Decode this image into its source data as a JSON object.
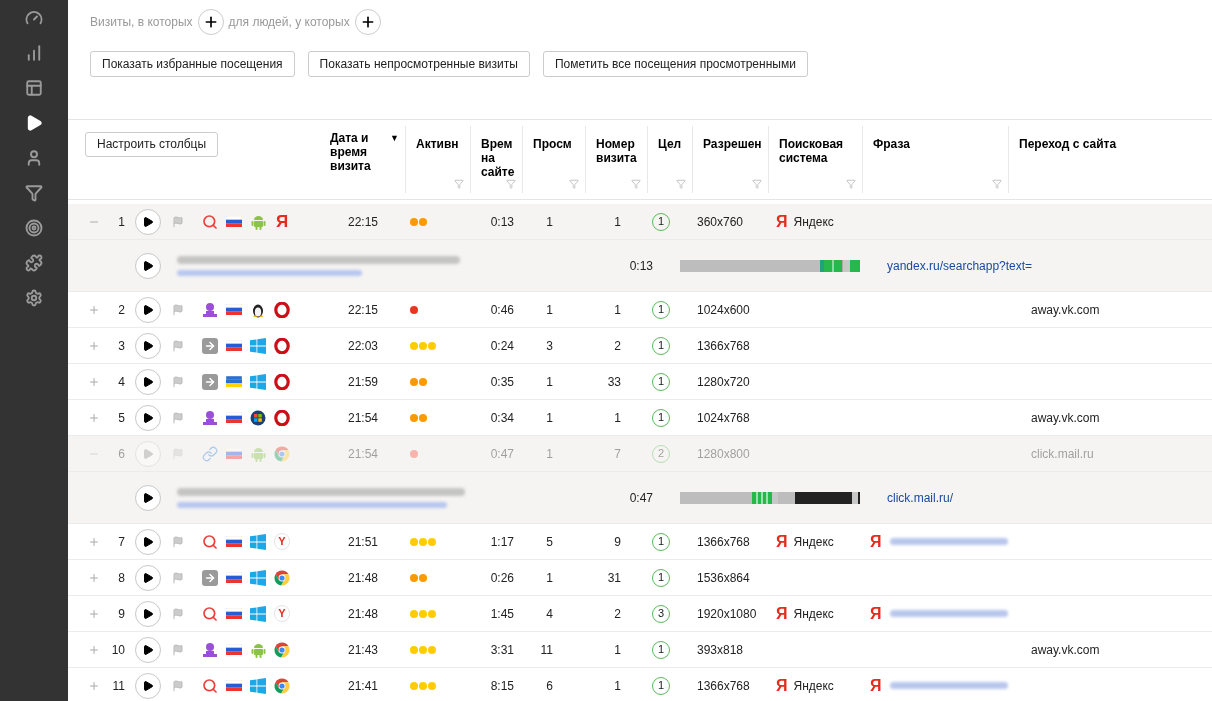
{
  "sidebar": {
    "items": [
      {
        "kind": "gauge",
        "selected": false
      },
      {
        "kind": "chart",
        "selected": false
      },
      {
        "kind": "layout",
        "selected": false
      },
      {
        "kind": "play",
        "selected": true
      },
      {
        "kind": "user",
        "selected": false
      },
      {
        "kind": "filter",
        "selected": false
      },
      {
        "kind": "target",
        "selected": false
      },
      {
        "kind": "puzzle",
        "selected": false
      },
      {
        "kind": "settings",
        "selected": false
      }
    ]
  },
  "filter_bar": {
    "visits_label": "Визиты, в которых",
    "people_label": "для людей, у которых"
  },
  "buttons": [
    "Показать избранные посещения",
    "Показать непросмотренные визиты",
    "Пометить все посещения просмотренными"
  ],
  "columns_button": "Настроить столбцы",
  "headers": [
    {
      "label": "Дата и время визита",
      "sort_mark": "▼",
      "filter": false
    },
    {
      "label": "Активн",
      "filter": true
    },
    {
      "label": "Врем на сайте",
      "filter": true
    },
    {
      "label": "Просм",
      "filter": true
    },
    {
      "label": "Номер визита",
      "filter": true
    },
    {
      "label": "Цел",
      "filter": true
    },
    {
      "label": "Разрешен",
      "filter": true
    },
    {
      "label": "Поисковая система",
      "filter": true
    },
    {
      "label": "Фраза",
      "filter": true
    },
    {
      "label": "Переход с сайта",
      "filter": false
    }
  ],
  "rows": [
    {
      "kind": "visit",
      "expanded": true,
      "faded": false,
      "number": "1",
      "icons": [
        {
          "kind": "search"
        },
        {
          "kind": "russia"
        },
        {
          "kind": "android"
        },
        {
          "kind": "yandex",
          "text": "Я"
        }
      ],
      "time": "22:15",
      "activity": [
        {
          "color": "#ff9900"
        },
        {
          "color": "#ff9900"
        }
      ],
      "duration": "0:13",
      "views": "1",
      "visit_number": "1",
      "goals": "1",
      "resolution": "360x760",
      "engine": {
        "logo": "Я",
        "name": "Яндекс"
      }
    },
    {
      "kind": "detail",
      "duration": "0:13",
      "url": "yandex.ru/searchapp?text=",
      "timeline": {
        "kind": "search"
      }
    },
    {
      "kind": "visit",
      "expanded": false,
      "faded": false,
      "number": "2",
      "icons": [
        {
          "kind": "social"
        },
        {
          "kind": "russia"
        },
        {
          "kind": "linux"
        },
        {
          "kind": "opera"
        }
      ],
      "time": "22:15",
      "activity": [
        {
          "color": "#ee3322"
        }
      ],
      "duration": "0:46",
      "views": "1",
      "visit_number": "1",
      "goals": "1",
      "resolution": "1024x600",
      "referrer": "away.vk.com"
    },
    {
      "kind": "visit",
      "expanded": false,
      "faded": false,
      "number": "3",
      "icons": [
        {
          "kind": "direct"
        },
        {
          "kind": "russia"
        },
        {
          "kind": "windows"
        },
        {
          "kind": "opera"
        }
      ],
      "time": "22:03",
      "activity": [
        {
          "color": "#ffcc00"
        },
        {
          "color": "#ffcc00"
        },
        {
          "color": "#ffcc00"
        }
      ],
      "duration": "0:24",
      "views": "3",
      "visit_number": "2",
      "goals": "1",
      "resolution": "1366x768"
    },
    {
      "kind": "visit",
      "expanded": false,
      "faded": false,
      "number": "4",
      "icons": [
        {
          "kind": "direct"
        },
        {
          "kind": "ukraine"
        },
        {
          "kind": "windows"
        },
        {
          "kind": "opera"
        }
      ],
      "time": "21:59",
      "activity": [
        {
          "color": "#ff9900"
        },
        {
          "color": "#ff9900"
        }
      ],
      "duration": "0:35",
      "views": "1",
      "visit_number": "33",
      "goals": "1",
      "resolution": "1280x720"
    },
    {
      "kind": "visit",
      "expanded": false,
      "faded": false,
      "number": "5",
      "icons": [
        {
          "kind": "social"
        },
        {
          "kind": "russia"
        },
        {
          "kind": "win7"
        },
        {
          "kind": "opera"
        }
      ],
      "time": "21:54",
      "activity": [
        {
          "color": "#ff9900"
        },
        {
          "color": "#ff9900"
        }
      ],
      "duration": "0:34",
      "views": "1",
      "visit_number": "1",
      "goals": "1",
      "resolution": "1024x768",
      "referrer": "away.vk.com"
    },
    {
      "kind": "visit",
      "expanded": true,
      "faded": true,
      "number": "6",
      "icons": [
        {
          "kind": "link"
        },
        {
          "kind": "russia"
        },
        {
          "kind": "android"
        },
        {
          "kind": "chrome"
        }
      ],
      "time": "21:54",
      "activity": [
        {
          "color": "#f8b4ac"
        }
      ],
      "duration": "0:47",
      "views": "1",
      "visit_number": "7",
      "goals": "2",
      "resolution": "1280x800",
      "referrer": "click.mail.ru"
    },
    {
      "kind": "detail",
      "duration": "0:47",
      "url": "click.mail.ru/",
      "timeline": {
        "kind": "mail"
      }
    },
    {
      "kind": "visit",
      "expanded": false,
      "faded": false,
      "number": "7",
      "icons": [
        {
          "kind": "search"
        },
        {
          "kind": "russia"
        },
        {
          "kind": "windows"
        },
        {
          "kind": "yandex_browser",
          "text": "Y"
        }
      ],
      "time": "21:51",
      "activity": [
        {
          "color": "#ffcc00"
        },
        {
          "color": "#ffcc00"
        },
        {
          "color": "#ffcc00"
        }
      ],
      "duration": "1:17",
      "views": "5",
      "visit_number": "9",
      "goals": "1",
      "resolution": "1366x768",
      "engine": {
        "logo": "Я",
        "name": "Яндекс"
      },
      "phrase": {
        "logo": "Я"
      }
    },
    {
      "kind": "visit",
      "expanded": false,
      "faded": false,
      "number": "8",
      "icons": [
        {
          "kind": "direct"
        },
        {
          "kind": "russia"
        },
        {
          "kind": "windows"
        },
        {
          "kind": "chrome"
        }
      ],
      "time": "21:48",
      "activity": [
        {
          "color": "#ff9900"
        },
        {
          "color": "#ff9900"
        }
      ],
      "duration": "0:26",
      "views": "1",
      "visit_number": "31",
      "goals": "1",
      "resolution": "1536x864"
    },
    {
      "kind": "visit",
      "expanded": false,
      "faded": false,
      "number": "9",
      "icons": [
        {
          "kind": "search"
        },
        {
          "kind": "russia"
        },
        {
          "kind": "windows"
        },
        {
          "kind": "yandex_browser",
          "text": "Y"
        }
      ],
      "time": "21:48",
      "activity": [
        {
          "color": "#ffcc00"
        },
        {
          "color": "#ffcc00"
        },
        {
          "color": "#ffcc00"
        }
      ],
      "duration": "1:45",
      "views": "4",
      "visit_number": "2",
      "goals": "3",
      "resolution": "1920x1080",
      "engine": {
        "logo": "Я",
        "name": "Яндекс"
      },
      "phrase": {
        "logo": "Я"
      }
    },
    {
      "kind": "visit",
      "expanded": false,
      "faded": false,
      "number": "10",
      "icons": [
        {
          "kind": "social"
        },
        {
          "kind": "russia"
        },
        {
          "kind": "android"
        },
        {
          "kind": "chrome"
        }
      ],
      "time": "21:43",
      "activity": [
        {
          "color": "#ffcc00"
        },
        {
          "color": "#ffcc00"
        },
        {
          "color": "#ffcc00"
        }
      ],
      "duration": "3:31",
      "views": "11",
      "visit_number": "1",
      "goals": "1",
      "resolution": "393x818",
      "referrer": "away.vk.com"
    },
    {
      "kind": "visit",
      "expanded": false,
      "faded": false,
      "number": "11",
      "icons": [
        {
          "kind": "search"
        },
        {
          "kind": "russia"
        },
        {
          "kind": "windows"
        },
        {
          "kind": "chrome"
        }
      ],
      "time": "21:41",
      "activity": [
        {
          "color": "#ffcc00"
        },
        {
          "color": "#ffcc00"
        },
        {
          "color": "#ffcc00"
        }
      ],
      "duration": "8:15",
      "views": "6",
      "visit_number": "1",
      "goals": "1",
      "resolution": "1366x768",
      "engine": {
        "logo": "Я",
        "name": "Яндекс"
      },
      "phrase": {
        "logo": "Я"
      }
    }
  ]
}
